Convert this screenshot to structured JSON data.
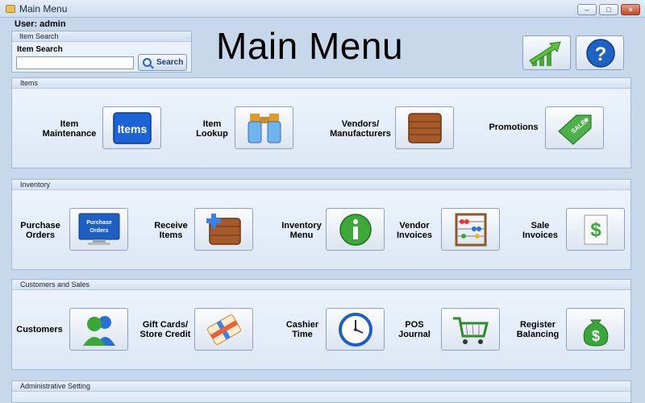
{
  "window": {
    "title": "Main Menu"
  },
  "user": {
    "label": "User: admin"
  },
  "search": {
    "group_title": "Item Search",
    "label": "Item Search",
    "value": "",
    "button_label": "Search"
  },
  "header": {
    "title": "Main Menu"
  },
  "sections": [
    {
      "title": "Items",
      "items": [
        {
          "label_lines": [
            "Item",
            "Maintenance"
          ],
          "icon": "items-icon"
        },
        {
          "label_lines": [
            "Item",
            "Lookup"
          ],
          "icon": "binoculars-icon"
        },
        {
          "label_lines": [
            "Vendors/",
            "Manufacturers"
          ],
          "icon": "crate-icon"
        },
        {
          "label_lines": [
            "Promotions"
          ],
          "icon": "sale-tag-icon"
        }
      ]
    },
    {
      "title": "Inventory",
      "items": [
        {
          "label_lines": [
            "Purchase",
            "Orders"
          ],
          "icon": "monitor-icon",
          "icon_text": [
            "Purchase",
            "Orders"
          ]
        },
        {
          "label_lines": [
            "Receive",
            "Items"
          ],
          "icon": "receive-crate-icon"
        },
        {
          "label_lines": [
            "Inventory",
            "Menu"
          ],
          "icon": "info-icon"
        },
        {
          "label_lines": [
            "Vendor",
            "Invoices"
          ],
          "icon": "abacus-icon"
        },
        {
          "label_lines": [
            "Sale",
            "Invoices"
          ],
          "icon": "invoice-icon"
        }
      ]
    },
    {
      "title": "Customers and Sales",
      "items": [
        {
          "label_lines": [
            "Customers"
          ],
          "icon": "people-icon"
        },
        {
          "label_lines": [
            "Gift Cards/",
            "Store Credit"
          ],
          "icon": "gift-card-icon"
        },
        {
          "label_lines": [
            "Cashier",
            "Time"
          ],
          "icon": "clock-icon"
        },
        {
          "label_lines": [
            "POS",
            "Journal"
          ],
          "icon": "cart-icon"
        },
        {
          "label_lines": [
            "Register",
            "Balancing"
          ],
          "icon": "money-bag-icon"
        }
      ]
    },
    {
      "title": "Administrative Setting",
      "items": []
    }
  ],
  "colors": {
    "accent": "#1f5fbf",
    "panel": "#e3ecf8",
    "green": "#4caf3a"
  }
}
